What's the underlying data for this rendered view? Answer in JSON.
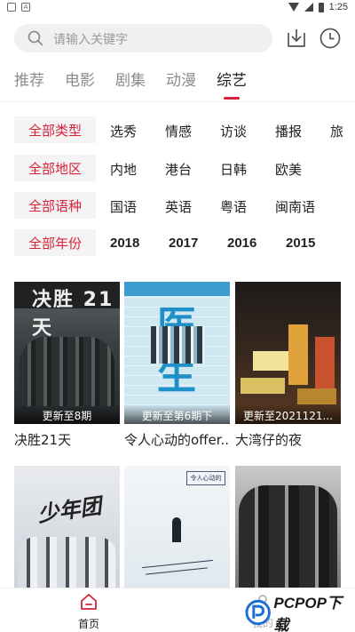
{
  "status_bar": {
    "time": "1:25"
  },
  "search": {
    "placeholder": "请输入关键字"
  },
  "category_tabs": [
    "推荐",
    "电影",
    "剧集",
    "动漫",
    "综艺"
  ],
  "filters": {
    "type": {
      "active": "全部类型",
      "options": [
        "选秀",
        "情感",
        "访谈",
        "播报",
        "旅"
      ]
    },
    "region": {
      "active": "全部地区",
      "options": [
        "内地",
        "港台",
        "日韩",
        "欧美"
      ]
    },
    "language": {
      "active": "全部语种",
      "options": [
        "国语",
        "英语",
        "粤语",
        "闽南语"
      ]
    },
    "year": {
      "active": "全部年份",
      "options": [
        "2018",
        "2017",
        "2016",
        "2015"
      ]
    }
  },
  "cards": [
    {
      "title": "决胜21天",
      "caption": "更新至8期",
      "poster_text": "决胜 21天"
    },
    {
      "title": "令人心动的offer...",
      "caption": "更新至第6期下",
      "poster_text": "医 生"
    },
    {
      "title": "大湾仔的夜",
      "caption": "更新至2021121...",
      "poster_text": ""
    },
    {
      "title": "",
      "caption": "",
      "poster_text": "少年团"
    },
    {
      "title": "",
      "caption": "",
      "poster_text": "令人心动的offer"
    },
    {
      "title": "",
      "caption": "",
      "poster_text": ""
    }
  ],
  "bottom_nav": {
    "home": "首页",
    "mine": "我的"
  },
  "watermark": {
    "text": "PCPOP下载"
  },
  "colors": {
    "accent": "#d6223a",
    "inactive": "#8c8c8c",
    "filter_bg": "#f4f4f4"
  }
}
